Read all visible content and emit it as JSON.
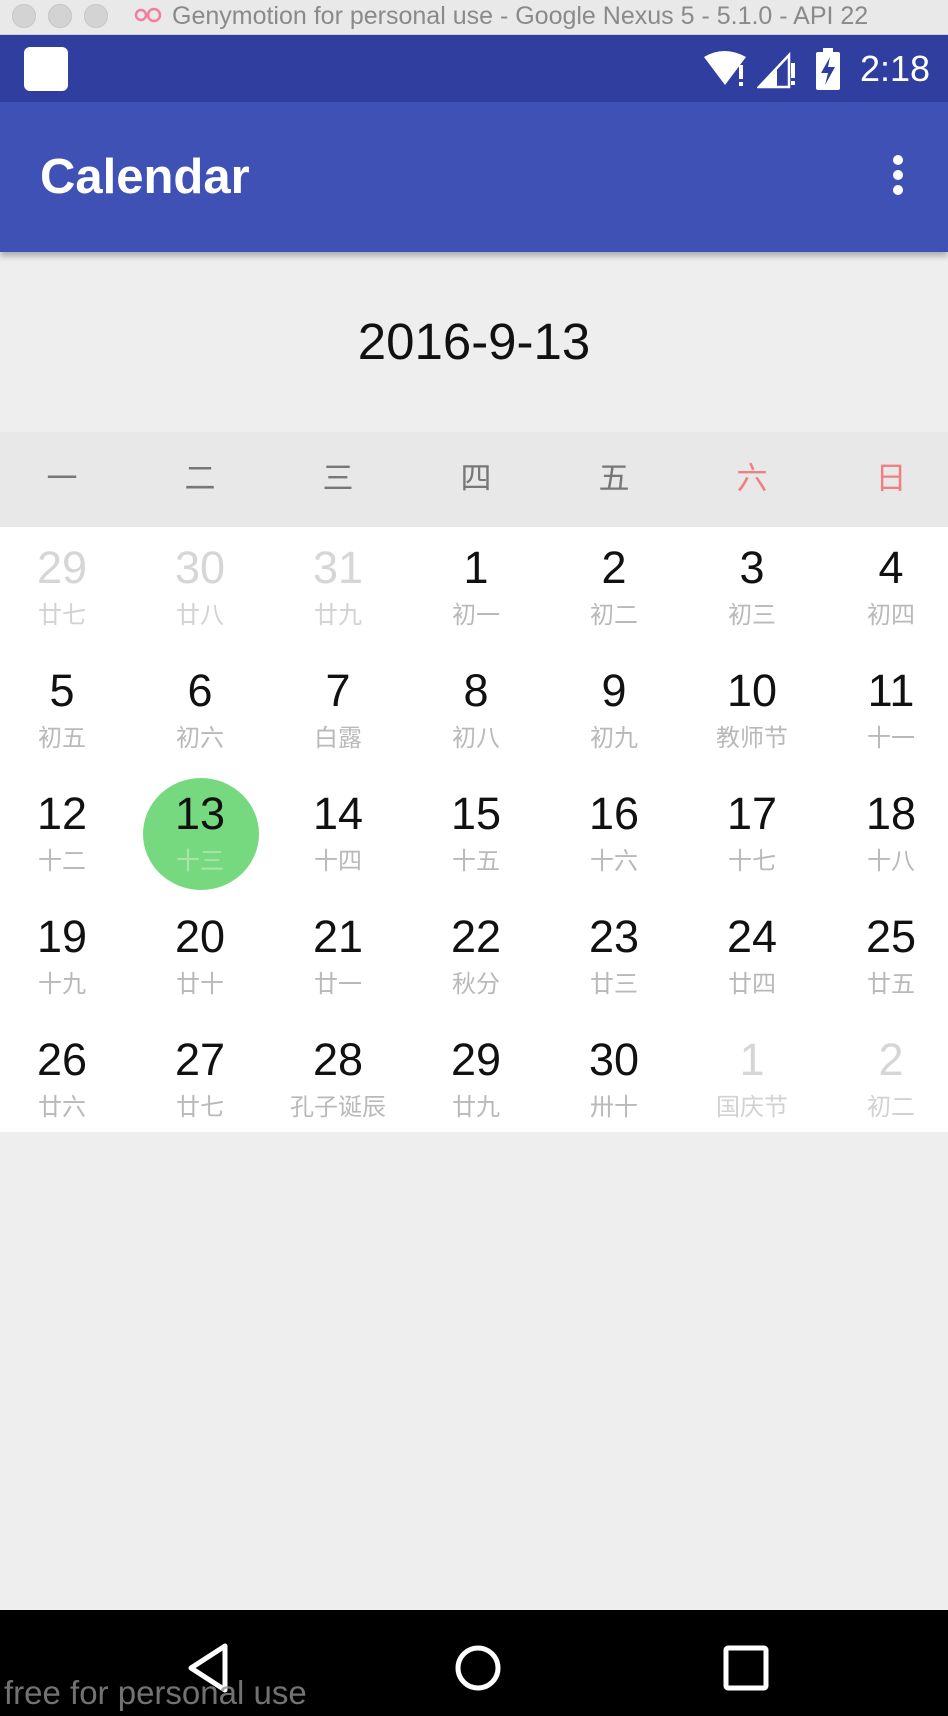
{
  "window": {
    "title": "Genymotion for personal use - Google Nexus 5 - 5.1.0 - API 22",
    "watermark": "free for personal use"
  },
  "status_bar": {
    "time": "2:18",
    "icons": [
      "app-notification-icon",
      "wifi-icon",
      "signal-icon",
      "battery-charging-icon"
    ]
  },
  "app_bar": {
    "title": "Calendar",
    "overflow_icon": "more-vert-icon"
  },
  "calendar": {
    "selected_date": "2016-9-13",
    "weekdays": [
      {
        "label": "一",
        "color": "#777777"
      },
      {
        "label": "二",
        "color": "#777777"
      },
      {
        "label": "三",
        "color": "#777777"
      },
      {
        "label": "四",
        "color": "#777777"
      },
      {
        "label": "五",
        "color": "#777777"
      },
      {
        "label": "六",
        "color": "#f08080"
      },
      {
        "label": "日",
        "color": "#f08080"
      }
    ],
    "selected_color": "#77d97f",
    "weeks": [
      [
        {
          "day": "29",
          "lunar": "廿七",
          "other_month": true
        },
        {
          "day": "30",
          "lunar": "廿八",
          "other_month": true
        },
        {
          "day": "31",
          "lunar": "廿九",
          "other_month": true
        },
        {
          "day": "1",
          "lunar": "初一"
        },
        {
          "day": "2",
          "lunar": "初二"
        },
        {
          "day": "3",
          "lunar": "初三"
        },
        {
          "day": "4",
          "lunar": "初四"
        }
      ],
      [
        {
          "day": "5",
          "lunar": "初五"
        },
        {
          "day": "6",
          "lunar": "初六"
        },
        {
          "day": "7",
          "lunar": "白露"
        },
        {
          "day": "8",
          "lunar": "初八"
        },
        {
          "day": "9",
          "lunar": "初九"
        },
        {
          "day": "10",
          "lunar": "教师节"
        },
        {
          "day": "11",
          "lunar": "十一"
        }
      ],
      [
        {
          "day": "12",
          "lunar": "十二"
        },
        {
          "day": "13",
          "lunar": "十三",
          "selected": true
        },
        {
          "day": "14",
          "lunar": "十四"
        },
        {
          "day": "15",
          "lunar": "十五"
        },
        {
          "day": "16",
          "lunar": "十六"
        },
        {
          "day": "17",
          "lunar": "十七"
        },
        {
          "day": "18",
          "lunar": "十八"
        }
      ],
      [
        {
          "day": "19",
          "lunar": "十九"
        },
        {
          "day": "20",
          "lunar": "廿十"
        },
        {
          "day": "21",
          "lunar": "廿一"
        },
        {
          "day": "22",
          "lunar": "秋分"
        },
        {
          "day": "23",
          "lunar": "廿三"
        },
        {
          "day": "24",
          "lunar": "廿四"
        },
        {
          "day": "25",
          "lunar": "廿五"
        }
      ],
      [
        {
          "day": "26",
          "lunar": "廿六"
        },
        {
          "day": "27",
          "lunar": "廿七"
        },
        {
          "day": "28",
          "lunar": "孔子诞辰"
        },
        {
          "day": "29",
          "lunar": "廿九"
        },
        {
          "day": "30",
          "lunar": "卅十"
        },
        {
          "day": "1",
          "lunar": "国庆节",
          "other_month": true
        },
        {
          "day": "2",
          "lunar": "初二",
          "other_month": true
        }
      ]
    ]
  },
  "nav_bar": {
    "icons": [
      "back-icon",
      "home-icon",
      "recents-icon"
    ]
  }
}
